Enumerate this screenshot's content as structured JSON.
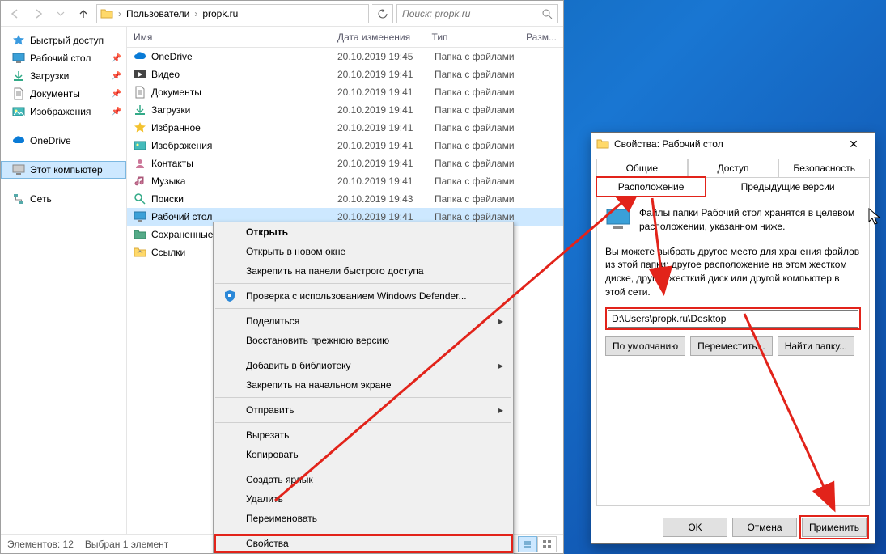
{
  "explorer": {
    "breadcrumb": {
      "part1": "Пользователи",
      "part2": "propk.ru"
    },
    "search_placeholder": "Поиск: propk.ru",
    "sidebar": {
      "quick_access": "Быстрый доступ",
      "desktop": "Рабочий стол",
      "downloads": "Загрузки",
      "documents": "Документы",
      "pictures": "Изображения",
      "onedrive": "OneDrive",
      "this_pc": "Этот компьютер",
      "network": "Сеть"
    },
    "columns": {
      "name": "Имя",
      "date": "Дата изменения",
      "type": "Тип",
      "size": "Разм..."
    },
    "rows": [
      {
        "name": "OneDrive",
        "date": "20.10.2019 19:45",
        "type": "Папка с файлами",
        "icon": "onedrive"
      },
      {
        "name": "Видео",
        "date": "20.10.2019 19:41",
        "type": "Папка с файлами",
        "icon": "video"
      },
      {
        "name": "Документы",
        "date": "20.10.2019 19:41",
        "type": "Папка с файлами",
        "icon": "docs"
      },
      {
        "name": "Загрузки",
        "date": "20.10.2019 19:41",
        "type": "Папка с файлами",
        "icon": "downloads"
      },
      {
        "name": "Избранное",
        "date": "20.10.2019 19:41",
        "type": "Папка с файлами",
        "icon": "star"
      },
      {
        "name": "Изображения",
        "date": "20.10.2019 19:41",
        "type": "Папка с файлами",
        "icon": "pictures"
      },
      {
        "name": "Контакты",
        "date": "20.10.2019 19:41",
        "type": "Папка с файлами",
        "icon": "contacts"
      },
      {
        "name": "Музыка",
        "date": "20.10.2019 19:41",
        "type": "Папка с файлами",
        "icon": "music"
      },
      {
        "name": "Поиски",
        "date": "20.10.2019 19:43",
        "type": "Папка с файлами",
        "icon": "search"
      },
      {
        "name": "Рабочий стол",
        "date": "20.10.2019 19:41",
        "type": "Папка с файлами",
        "icon": "desktop",
        "selected": true
      },
      {
        "name": "Сохраненные ...",
        "date": "",
        "type": "",
        "icon": "saved"
      },
      {
        "name": "Ссылки",
        "date": "",
        "type": "",
        "icon": "links"
      }
    ],
    "status": {
      "count": "Элементов: 12",
      "selected": "Выбран 1 элемент"
    }
  },
  "context_menu": {
    "open": "Открыть",
    "open_new": "Открыть в новом окне",
    "pin_quick": "Закрепить на панели быстрого доступа",
    "defender": "Проверка с использованием Windows Defender...",
    "share": "Поделиться",
    "restore": "Восстановить прежнюю версию",
    "add_lib": "Добавить в библиотеку",
    "pin_start": "Закрепить на начальном экране",
    "send_to": "Отправить",
    "cut": "Вырезать",
    "copy": "Копировать",
    "shortcut": "Создать ярлык",
    "delete": "Удалить",
    "rename": "Переименовать",
    "properties": "Свойства"
  },
  "props": {
    "title": "Свойства: Рабочий стол",
    "tabs": {
      "general": "Общие",
      "access": "Доступ",
      "security": "Безопасность",
      "location": "Расположение",
      "prev": "Предыдущие версии"
    },
    "text1": "Файлы папки Рабочий стол хранятся в целевом расположении, указанном ниже.",
    "text2": "Вы можете выбрать другое место для хранения файлов из этой папки: другое расположение на этом жестком диске, другой жесткий диск или другой компьютер в этой сети.",
    "path": "D:\\Users\\propk.ru\\Desktop",
    "btn_default": "По умолчанию",
    "btn_move": "Переместить...",
    "btn_find": "Найти папку...",
    "btn_ok": "OK",
    "btn_cancel": "Отмена",
    "btn_apply": "Применить"
  }
}
